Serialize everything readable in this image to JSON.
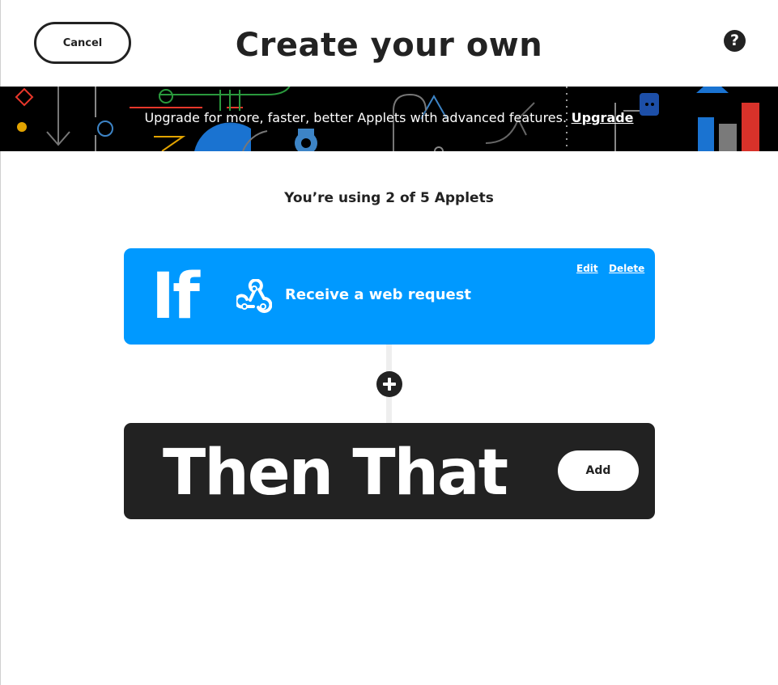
{
  "header": {
    "cancel_label": "Cancel",
    "title": "Create your own",
    "help_icon": "question-circle-icon",
    "help_glyph": "?"
  },
  "banner": {
    "message": "Upgrade for more, faster, better Applets with advanced features.",
    "link_label": "Upgrade"
  },
  "usage": {
    "text": "You’re using 2 of 5 Applets"
  },
  "if_card": {
    "keyword": "If",
    "trigger_icon": "webhooks-icon",
    "trigger_label": "Receive a web request",
    "edit_label": "Edit",
    "delete_label": "Delete",
    "color": "#0099ff"
  },
  "connector": {
    "add_icon": "plus-circle-icon"
  },
  "then_card": {
    "keyword": "Then That",
    "add_label": "Add",
    "color": "#222222"
  }
}
